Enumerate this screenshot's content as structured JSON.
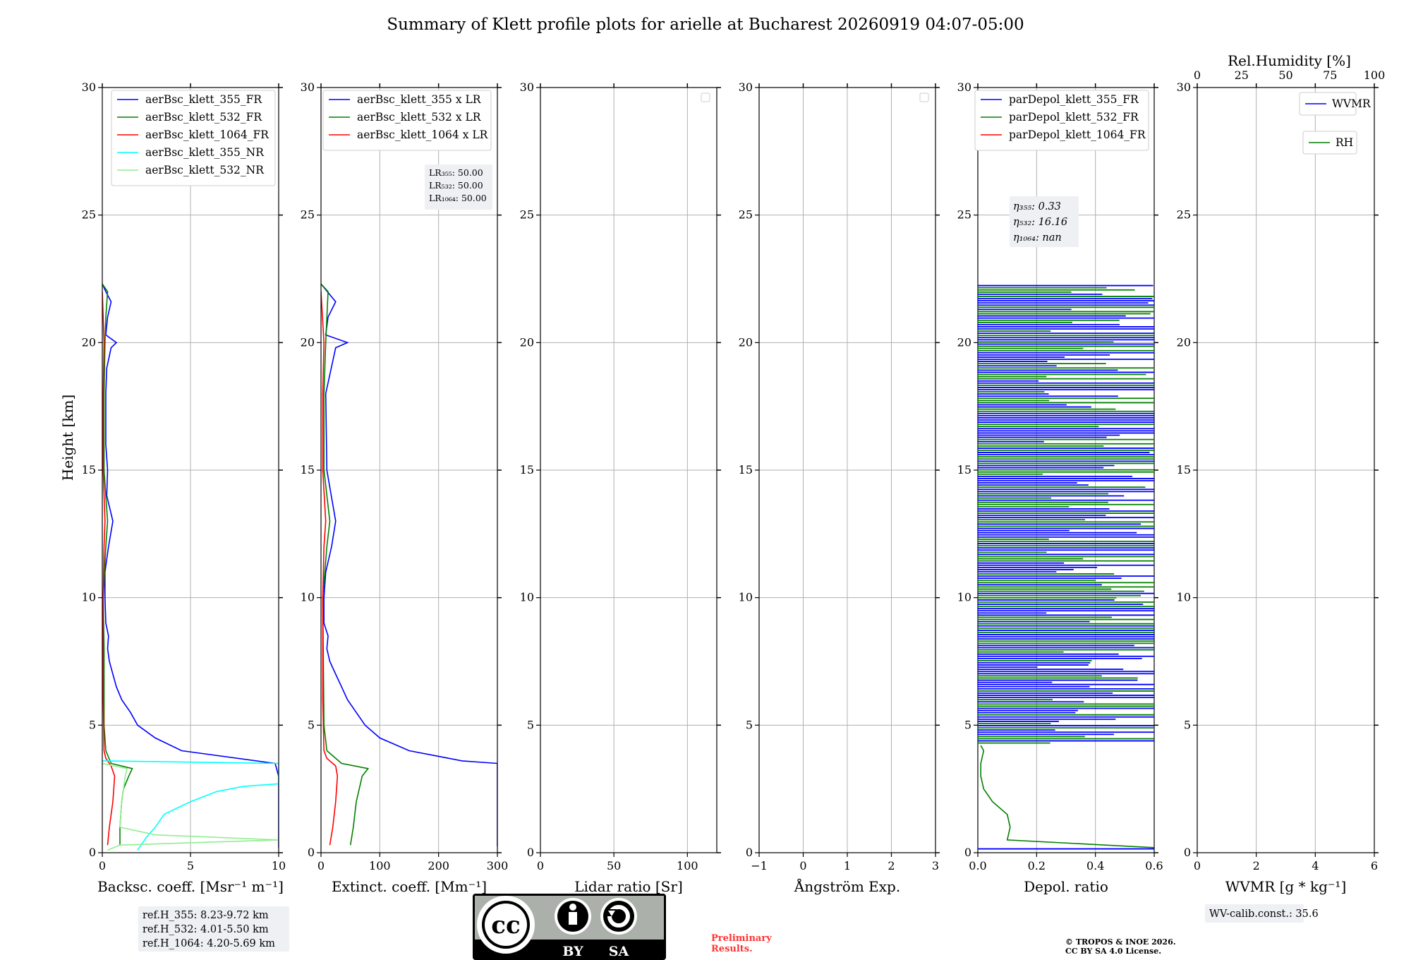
{
  "title": "Summary of Klett profile plots for arielle at Bucharest 20260919 04:07-05:00",
  "height_axis_label": "Height [km]",
  "y_ticks": [
    "0",
    "5",
    "10",
    "15",
    "20",
    "25",
    "30"
  ],
  "chart_data": [
    {
      "type": "line",
      "xlabel": "Backsc. coeff. [Msr⁻¹ m⁻¹]",
      "xlim": [
        0,
        10
      ],
      "ylim": [
        0,
        30
      ],
      "x_ticks": [
        "0",
        "5",
        "10"
      ],
      "legend": "top-right",
      "series": [
        {
          "name": "aerBsc_klett_355_FR",
          "color": "#0000ff",
          "y": [
            0.2,
            0.5,
            1,
            2,
            3,
            3.5,
            4,
            4.5,
            5,
            5.5,
            6,
            6.5,
            7,
            7.5,
            8,
            8.5,
            9,
            10,
            11,
            12,
            13,
            14,
            15,
            16,
            17,
            18,
            19,
            19.8,
            20,
            20.3,
            21,
            21.6,
            22,
            22.3
          ],
          "x": [
            10,
            10,
            10,
            10,
            10,
            9.8,
            4.5,
            3,
            2,
            1.6,
            1.1,
            0.8,
            0.6,
            0.4,
            0.3,
            0.35,
            0.2,
            0.15,
            0.15,
            0.35,
            0.6,
            0.25,
            0.3,
            0.2,
            0.2,
            0.2,
            0.25,
            0.5,
            0.8,
            0.2,
            0.3,
            0.5,
            0.2,
            0
          ]
        },
        {
          "name": "aerBsc_klett_532_FR",
          "color": "#008000",
          "y": [
            0.3,
            1,
            2,
            2.5,
            3,
            3.3,
            3.5,
            4,
            5,
            8,
            10,
            12,
            13,
            15,
            18,
            20,
            21,
            22,
            22.3
          ],
          "x": [
            1,
            1,
            1.1,
            1.2,
            1.5,
            1.7,
            0.5,
            0.2,
            0.1,
            0.1,
            0.05,
            0.2,
            0.3,
            0.1,
            0.1,
            0.15,
            0.2,
            0.3,
            0
          ]
        },
        {
          "name": "aerBsc_klett_1064_FR",
          "color": "#ff0000",
          "y": [
            0.3,
            1,
            2,
            3,
            3.4,
            3.7,
            4,
            6,
            10,
            12,
            13,
            15,
            18,
            20,
            22
          ],
          "x": [
            0.3,
            0.4,
            0.6,
            0.7,
            0.5,
            0.2,
            0.1,
            0.05,
            0.05,
            0.1,
            0.15,
            0.05,
            0.05,
            0.1,
            0
          ]
        },
        {
          "name": "aerBsc_klett_355_NR",
          "color": "#00ffff",
          "y": [
            0.1,
            0.3,
            0.6,
            1,
            1.5,
            2,
            2.4,
            2.6,
            2.7,
            3.5,
            3.6
          ],
          "x": [
            2,
            2.2,
            2.5,
            3,
            3.5,
            5,
            6.5,
            8,
            10,
            10,
            0
          ]
        },
        {
          "name": "aerBsc_klett_532_NR",
          "color": "#90ee90",
          "y": [
            0.1,
            0.3,
            0.5,
            0.7,
            1,
            2,
            3,
            3.3,
            3.5
          ],
          "x": [
            0.3,
            1,
            10,
            3,
            1,
            1.1,
            1.3,
            1.4,
            0
          ]
        }
      ],
      "annotation": [
        "ref.H_355: 8.23-9.72 km",
        "ref.H_532: 4.01-5.50 km",
        "ref.H_1064: 4.20-5.69 km"
      ]
    },
    {
      "type": "line",
      "xlabel": "Extinct. coeff. [Mm⁻¹]",
      "xlim": [
        0,
        300
      ],
      "ylim": [
        0,
        30
      ],
      "x_ticks": [
        "0",
        "100",
        "200",
        "300"
      ],
      "legend": "top-right",
      "series": [
        {
          "name": "aerBsc_klett_355 x LR",
          "color": "#0000ff",
          "y": [
            0.25,
            3.5,
            3.6,
            4,
            4.5,
            5,
            5.5,
            6,
            6.5,
            7,
            7.5,
            8,
            8.5,
            9,
            10,
            11,
            12,
            13,
            15,
            18,
            19.8,
            20,
            20.3,
            21,
            21.6,
            22.3
          ],
          "x": [
            300,
            300,
            240,
            150,
            100,
            75,
            60,
            45,
            35,
            25,
            15,
            10,
            12,
            5,
            5,
            8,
            18,
            25,
            10,
            8,
            25,
            45,
            8,
            12,
            25,
            0
          ]
        },
        {
          "name": "aerBsc_klett_532 x LR",
          "color": "#008000",
          "y": [
            0.3,
            1,
            2,
            2.5,
            3,
            3.3,
            3.5,
            4,
            5,
            10,
            12,
            13,
            15,
            18,
            20,
            22,
            22.3
          ],
          "x": [
            50,
            55,
            60,
            65,
            70,
            80,
            35,
            10,
            5,
            3,
            10,
            15,
            5,
            5,
            8,
            12,
            0
          ]
        },
        {
          "name": "aerBsc_klett_1064 x LR",
          "color": "#ff0000",
          "y": [
            0.3,
            1,
            2,
            3,
            3.4,
            3.7,
            4,
            6,
            10,
            12,
            13,
            15,
            18,
            20,
            22
          ],
          "x": [
            15,
            20,
            25,
            28,
            25,
            10,
            5,
            3,
            3,
            5,
            8,
            3,
            3,
            5,
            0
          ]
        }
      ],
      "annotation": [
        "LR₃₅₅: 50.00",
        "LR₅₃₂: 50.00",
        "LR₁₀₆₄: 50.00"
      ]
    },
    {
      "type": "line",
      "xlabel": "Lidar ratio [Sr]",
      "xlim": [
        0,
        120
      ],
      "ylim": [
        0,
        30
      ],
      "x_ticks": [
        "0",
        "50",
        "100"
      ],
      "series": []
    },
    {
      "type": "line",
      "xlabel": "Ångström Exp.",
      "xlim": [
        -1,
        3
      ],
      "ylim": [
        0,
        30
      ],
      "x_ticks": [
        "−1",
        "0",
        "1",
        "2",
        "3"
      ],
      "series": []
    },
    {
      "type": "line",
      "xlabel": "Depol. ratio",
      "xlim": [
        0,
        0.6
      ],
      "ylim": [
        0,
        30
      ],
      "x_ticks": [
        "0.0",
        "0.2",
        "0.4",
        "0.6"
      ],
      "legend": "top-right",
      "series": [
        {
          "name": "parDepol_klett_355_FR",
          "color": "#0000ff",
          "y": [],
          "x": []
        },
        {
          "name": "parDepol_klett_532_FR",
          "color": "#008000",
          "y": [
            0.2,
            0.5,
            1,
            1.5,
            2,
            2.5,
            3,
            3.5,
            4,
            4.2
          ],
          "x": [
            0.6,
            0.1,
            0.11,
            0.1,
            0.05,
            0.02,
            0.01,
            0.01,
            0.02,
            0.01
          ]
        },
        {
          "name": "parDepol_klett_1064_FR",
          "color": "#ff0000",
          "y": [],
          "x": []
        }
      ],
      "annotation": [
        "η₃₅₅: 0.33",
        "η₅₃₂: 16.16",
        "η₁₀₆₄: nan"
      ]
    },
    {
      "type": "line",
      "xlabel": "WVMR [g * kg⁻¹]",
      "top_xlabel": "Rel.Humidity [%]",
      "xlim": [
        0,
        6
      ],
      "ylim": [
        0,
        30
      ],
      "x_ticks": [
        "0",
        "2",
        "4",
        "6"
      ],
      "top_x_ticks": [
        "0",
        "25",
        "50",
        "75",
        "100"
      ],
      "legend": "top-right",
      "series": [
        {
          "name": "WVMR",
          "color": "#0000ff",
          "y": [],
          "x": []
        },
        {
          "name": "RH",
          "color": "#008000",
          "y": [],
          "x": []
        }
      ],
      "annotation": [
        "WV-calib.const.: 35.6"
      ]
    }
  ],
  "license_badge": {
    "cc": "cc",
    "by": "BY",
    "sa": "SA"
  },
  "preliminary": [
    "Preliminary",
    "Results."
  ],
  "copyright": [
    "© TROPOS & INOE 2026.",
    "CC BY SA 4.0 License."
  ]
}
